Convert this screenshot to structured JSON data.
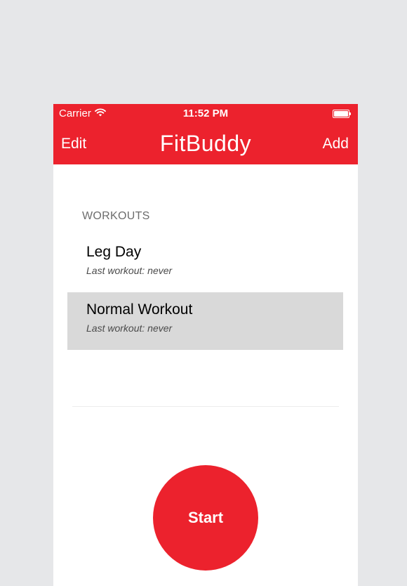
{
  "status_bar": {
    "carrier": "Carrier",
    "time": "11:52 PM",
    "wifi_icon": "wifi-icon",
    "battery_icon": "battery-icon"
  },
  "nav": {
    "left_button": "Edit",
    "title": "FitBuddy",
    "right_button": "Add"
  },
  "section": {
    "header": "WORKOUTS"
  },
  "workouts": [
    {
      "title": "Leg Day",
      "subtitle": "Last workout:  never",
      "selected": false
    },
    {
      "title": "Normal Workout",
      "subtitle": "Last workout:  never",
      "selected": true
    }
  ],
  "start_button": {
    "label": "Start"
  },
  "colors": {
    "accent": "#ec222d",
    "background": "#e6e7e9",
    "selected_row": "#d9d9d9"
  }
}
